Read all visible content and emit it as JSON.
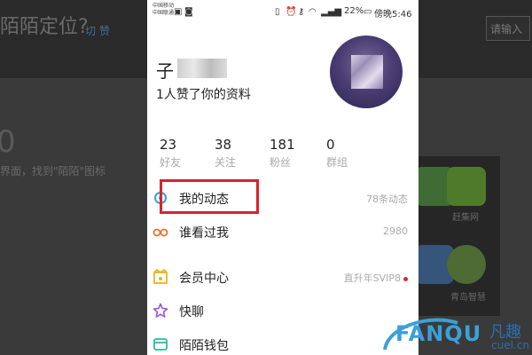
{
  "background": {
    "title": "陌陌定位?",
    "link": "切 赞",
    "input_label": "请输入",
    "step": "0",
    "instruction": "界面，找到\"陌陌\"图标",
    "apps": [
      {
        "label": "赶集网",
        "icon": "ganji-app-icon",
        "color": "#8fc24f"
      },
      {
        "label": "青岛智慧",
        "icon": "android-app-icon",
        "color": "#9ccf5a"
      }
    ]
  },
  "status_bar": {
    "carrier1": "中国移动",
    "carrier2": "中国联通",
    "battery": "22%",
    "time": "傍晚5:46"
  },
  "profile": {
    "name_char": "子",
    "likes_text": "1人赞了你的资料"
  },
  "stats": [
    {
      "value": "23",
      "label": "好友"
    },
    {
      "value": "38",
      "label": "关注"
    },
    {
      "value": "181",
      "label": "粉丝"
    },
    {
      "value": "0",
      "label": "群组"
    }
  ],
  "menu": [
    {
      "label": "我的动态",
      "right": "78条动态",
      "icon": "moments-icon"
    },
    {
      "label": "谁看过我",
      "right": "2980",
      "icon": "glasses-icon"
    },
    {
      "label": "会员中心",
      "right": "直升年SVIP8",
      "icon": "vip-icon"
    },
    {
      "label": "快聊",
      "right": "",
      "icon": "star-icon"
    },
    {
      "label": "陌陌钱包",
      "right": "",
      "icon": "wallet-icon"
    }
  ],
  "colors": {
    "highlight": "#d9232a",
    "accent": "#3aa0d8"
  },
  "watermark": {
    "brand": "FANQU",
    "cn": "凡趣",
    "url": "cuel.cn"
  }
}
